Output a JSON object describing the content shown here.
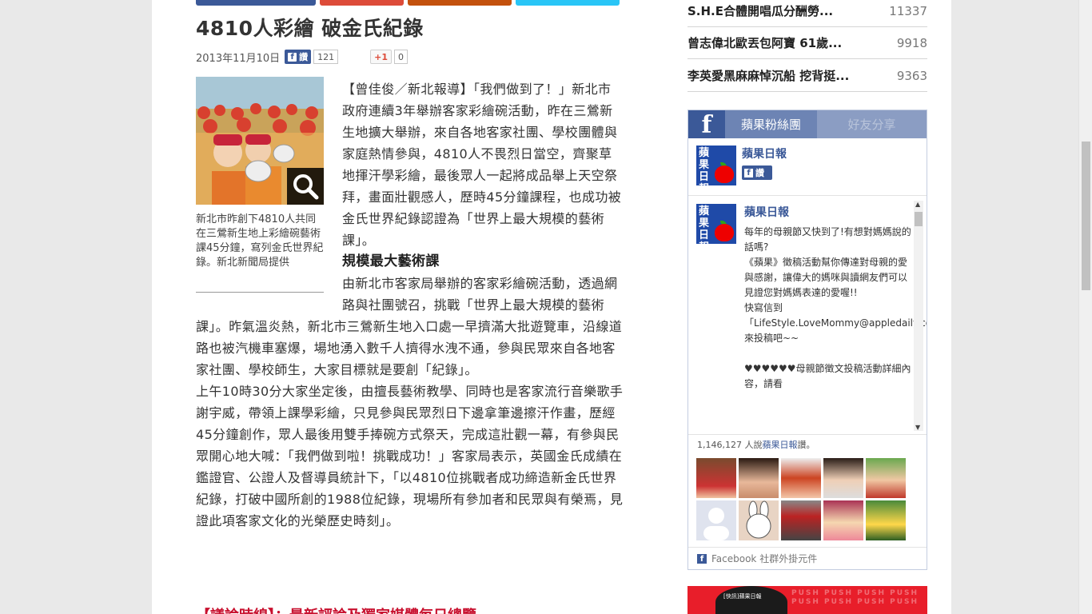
{
  "article": {
    "title": "4810人彩繪 破金氏紀錄",
    "date": "2013年11月10日",
    "like_label": "讚",
    "like_count": "121",
    "gplus_label": "+1",
    "gplus_count": "0",
    "photo_caption": "新北市昨創下4810人共同在三鶯新生地上彩繪碗藝術課45分鐘，寫列金氏世界紀錄。新北新聞局提供",
    "paragraphs": [
      "【曾佳俊／新北報導】「我們做到了！」新北市政府連續3年舉辦客家彩繪碗活動，昨在三鶯新生地擴大舉辦，來自各地客家社團、學校團體與家庭熱情參與，4810人不畏烈日當空，齊聚草地揮汗學彩繪，最後眾人一起將成品舉上天空祭拜，畫面壯觀感人，歷時45分鐘課程，也成功被金氏世界紀錄認證為「世界上最大規模的藝術課」。"
    ],
    "subhead": "規模最大藝術課",
    "paragraphs2": [
      "由新北市客家局舉辦的客家彩繪碗活動，透過網路與社團號召，挑戰「世界上最大規模的藝術課」。昨氣溫炎熱，新北市三鶯新生地入口處一早擠滿大批遊覽車，沿線道路也被汽機車塞爆，場地湧入數千人擠得水洩不通，參與民眾來自各地客家社團、學校師生，大家目標就是要創「紀錄」。",
      "上午10時30分大家坐定後，由擅長藝術教學、同時也是客家流行音樂歌手謝宇威，帶領上課學彩繪，只見參與民眾烈日下邊拿筆邊擦汗作畫，歷經45分鐘創作，眾人最後用雙手捧碗方式祭天，完成這壯觀一幕，有參與民眾開心地大喊：「我們做到啦！挑戰成功！」客家局表示，英國金氏成績在鑑證官、公證人及督導員統計下，「以4810位挑戰者成功締造新金氏世界紀錄，打破中國所創的1988位紀錄，現場所有參加者和民眾與有榮焉，見證此項客家文化的光榮歷史時刻」。"
    ],
    "bottom_link": "【議論時線】：最新評論及獨家媒體每日總覽"
  },
  "ranking": [
    {
      "title": "S.H.E合體開唱瓜分酬勞...",
      "count": "11337"
    },
    {
      "title": "曾志偉北歐丟包阿寶 61歲...",
      "count": "9918"
    },
    {
      "title": "李英愛黑麻麻悼沉船 挖背挺...",
      "count": "9363"
    }
  ],
  "fb_widget": {
    "tab_active": "蘋果粉絲團",
    "tab_inactive": "好友分享",
    "page_name": "蘋果日報",
    "logo_text": "蘋果日報",
    "like_label": "讚",
    "post_author": "蘋果日報",
    "post_text": "每年的母親節又快到了!有想對媽媽說的話嗎?\n《蘋果》徵稿活動幫你傳達對母親的愛與感謝，讓偉大的媽咪與讀網友們可以見證您對媽媽表達的愛喔!!\n快寫信到「LifeStyle.LoveMommy@appledaily.com.tw」來投稿吧~~\n\n♥♥♥♥♥♥母親節徵文投稿活動詳細內容，請看",
    "like_count_prefix": "1,146,127 人說",
    "like_count_link": "蘋果日報",
    "like_count_suffix": "讚。",
    "footer": "Facebook 社群外掛元件"
  },
  "ad": {
    "push_text": "PUSH PUSH PUSH PUSH PUSH PUSH PUSH PUSH",
    "inner_text": "[快訊]蘋果日報"
  }
}
